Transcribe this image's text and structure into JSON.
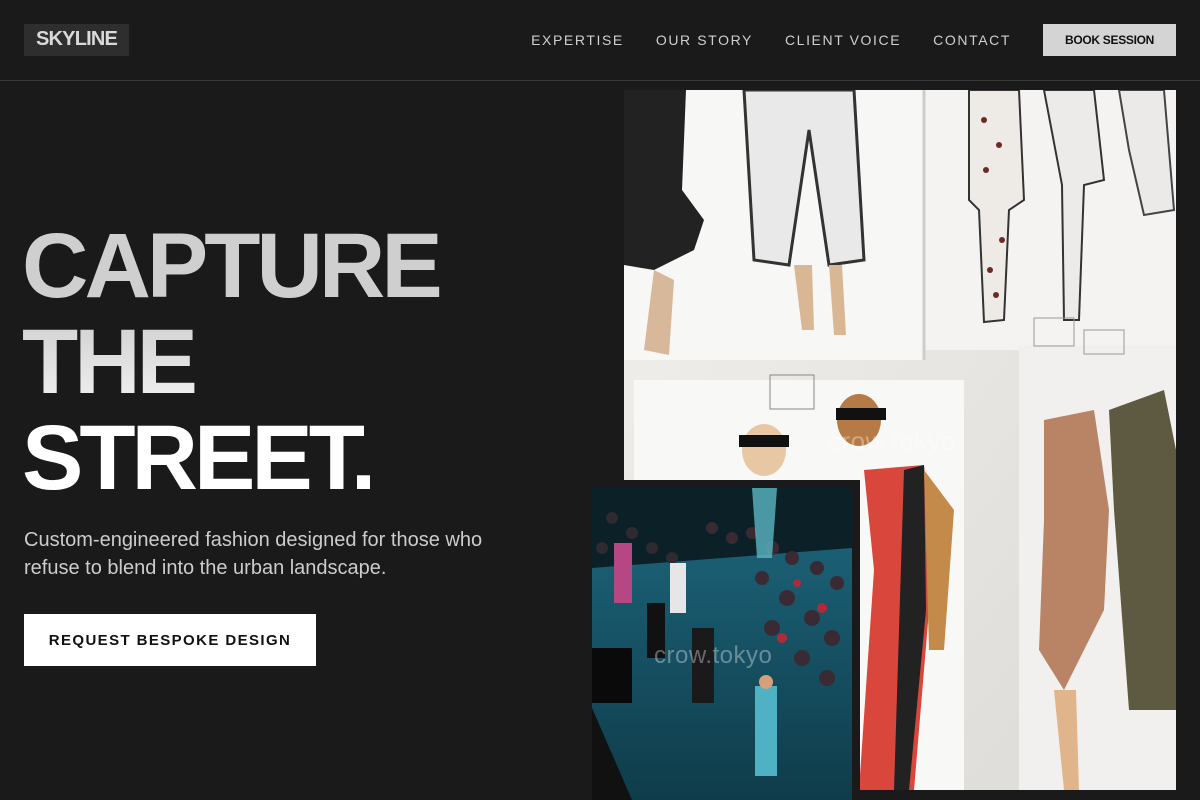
{
  "header": {
    "logo": "SKYLINE",
    "nav": [
      {
        "label": "EXPERTISE"
      },
      {
        "label": "OUR STORY"
      },
      {
        "label": "CLIENT VOICE"
      },
      {
        "label": "CONTACT"
      }
    ],
    "book_label": "BOOK SESSION"
  },
  "hero": {
    "title_lines": [
      "CAPTURE",
      "THE",
      "STREET."
    ],
    "subtitle": "Custom-engineered fashion designed for those who refuse to blend into the urban landscape.",
    "cta_label": "REQUEST BESPOKE DESIGN"
  },
  "images": {
    "sketch_watermark": "crow.tokyo",
    "runway_watermark": "crow.tokyo"
  },
  "colors": {
    "background": "#1a1a1a",
    "nav_text": "#cfcfcf",
    "book_button_bg": "#d4d4d4",
    "cta_bg": "#ffffff"
  }
}
